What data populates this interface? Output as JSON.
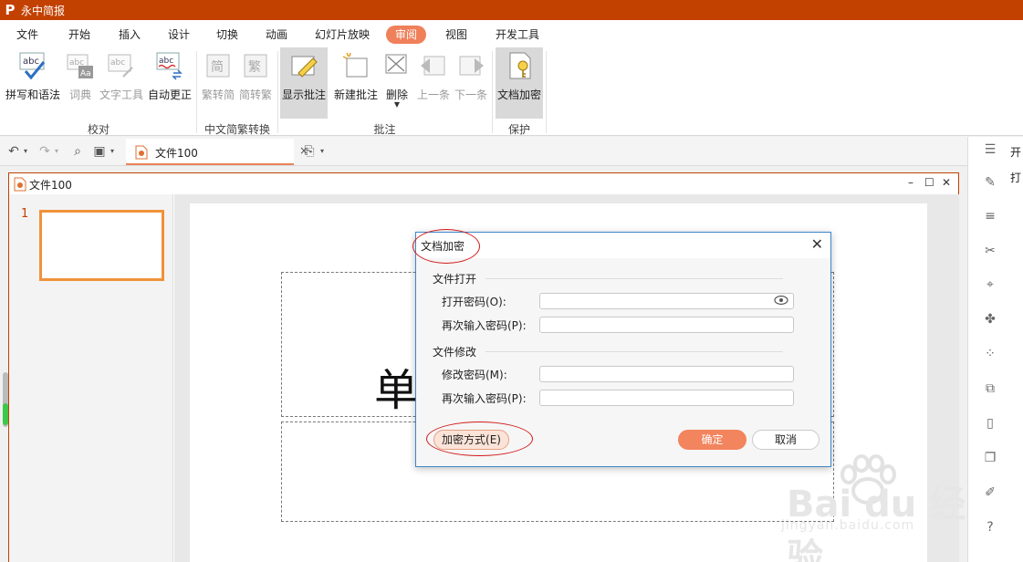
{
  "app": {
    "title": "永中简报",
    "logo_letter": "P"
  },
  "menu": {
    "items": [
      {
        "label": "文件"
      },
      {
        "label": "开始"
      },
      {
        "label": "插入"
      },
      {
        "label": "设计"
      },
      {
        "label": "切换"
      },
      {
        "label": "动画"
      },
      {
        "label": "幻灯片放映"
      },
      {
        "label": "审阅",
        "active": true
      },
      {
        "label": "视图"
      },
      {
        "label": "开发工具"
      }
    ]
  },
  "ribbon": {
    "buttons": [
      {
        "label": "拼写和语法",
        "icon": "spellcheck-icon"
      },
      {
        "label": "词典",
        "icon": "dictionary-icon",
        "disabled": true
      },
      {
        "label": "文字工具",
        "icon": "text-tools-icon",
        "disabled": true
      },
      {
        "label": "自动更正",
        "icon": "autocorrect-icon"
      },
      {
        "label": "繁转简",
        "icon": "trad-to-simp-icon",
        "disabled": true
      },
      {
        "label": "简转繁",
        "icon": "simp-to-trad-icon",
        "disabled": true
      },
      {
        "label": "显示批注",
        "icon": "show-comments-icon",
        "pressed": true
      },
      {
        "label": "新建批注",
        "icon": "new-comment-icon"
      },
      {
        "label": "删除",
        "icon": "delete-comment-icon"
      },
      {
        "label": "上一条",
        "icon": "previous-comment-icon",
        "disabled": true
      },
      {
        "label": "下一条",
        "icon": "next-comment-icon",
        "disabled": true
      },
      {
        "label": "文档加密",
        "icon": "encrypt-document-icon",
        "pressed": true
      }
    ],
    "groups": [
      {
        "label": "校对"
      },
      {
        "label": "中文简繁转换"
      },
      {
        "label": "批注"
      },
      {
        "label": "保护"
      }
    ]
  },
  "quickbar": {
    "icons": [
      "undo-icon",
      "redo-icon",
      "print-preview-icon",
      "save-icon",
      "new-slide-icon"
    ],
    "tab_name": "文件100",
    "close_glyph": "×"
  },
  "right_panel": {
    "texts": [
      "开",
      "打"
    ],
    "icons": [
      "menu-icon",
      "pencil-icon",
      "settings-sliders-icon",
      "tools-icon",
      "pin-icon",
      "shape-icon",
      "apps-icon",
      "image-edit-icon",
      "clipboard-icon",
      "copy-icon",
      "edit-icon",
      "help-icon"
    ]
  },
  "document": {
    "window_title": "文件100",
    "slide_number": "1",
    "slide_title_text": "单"
  },
  "dialog": {
    "title": "文档加密",
    "close_glyph": "✕",
    "section_open": "文件打开",
    "open_password_label": "打开密码(O):",
    "open_password_confirm_label": "再次输入密码(P):",
    "section_modify": "文件修改",
    "modify_password_label": "修改密码(M):",
    "modify_password_confirm_label": "再次输入密码(P):",
    "encrypt_method_button": "加密方式(E)",
    "ok_button": "确定",
    "cancel_button": "取消"
  },
  "watermark": {
    "brand": "Bai du 经验",
    "url": "jingyan.baidu.com"
  },
  "colors": {
    "titlebar": "#c24000",
    "accent": "#f0805a",
    "ok_button": "#f2845e",
    "annotation": "#d21a1a",
    "dialog_border": "#3c87c8"
  }
}
